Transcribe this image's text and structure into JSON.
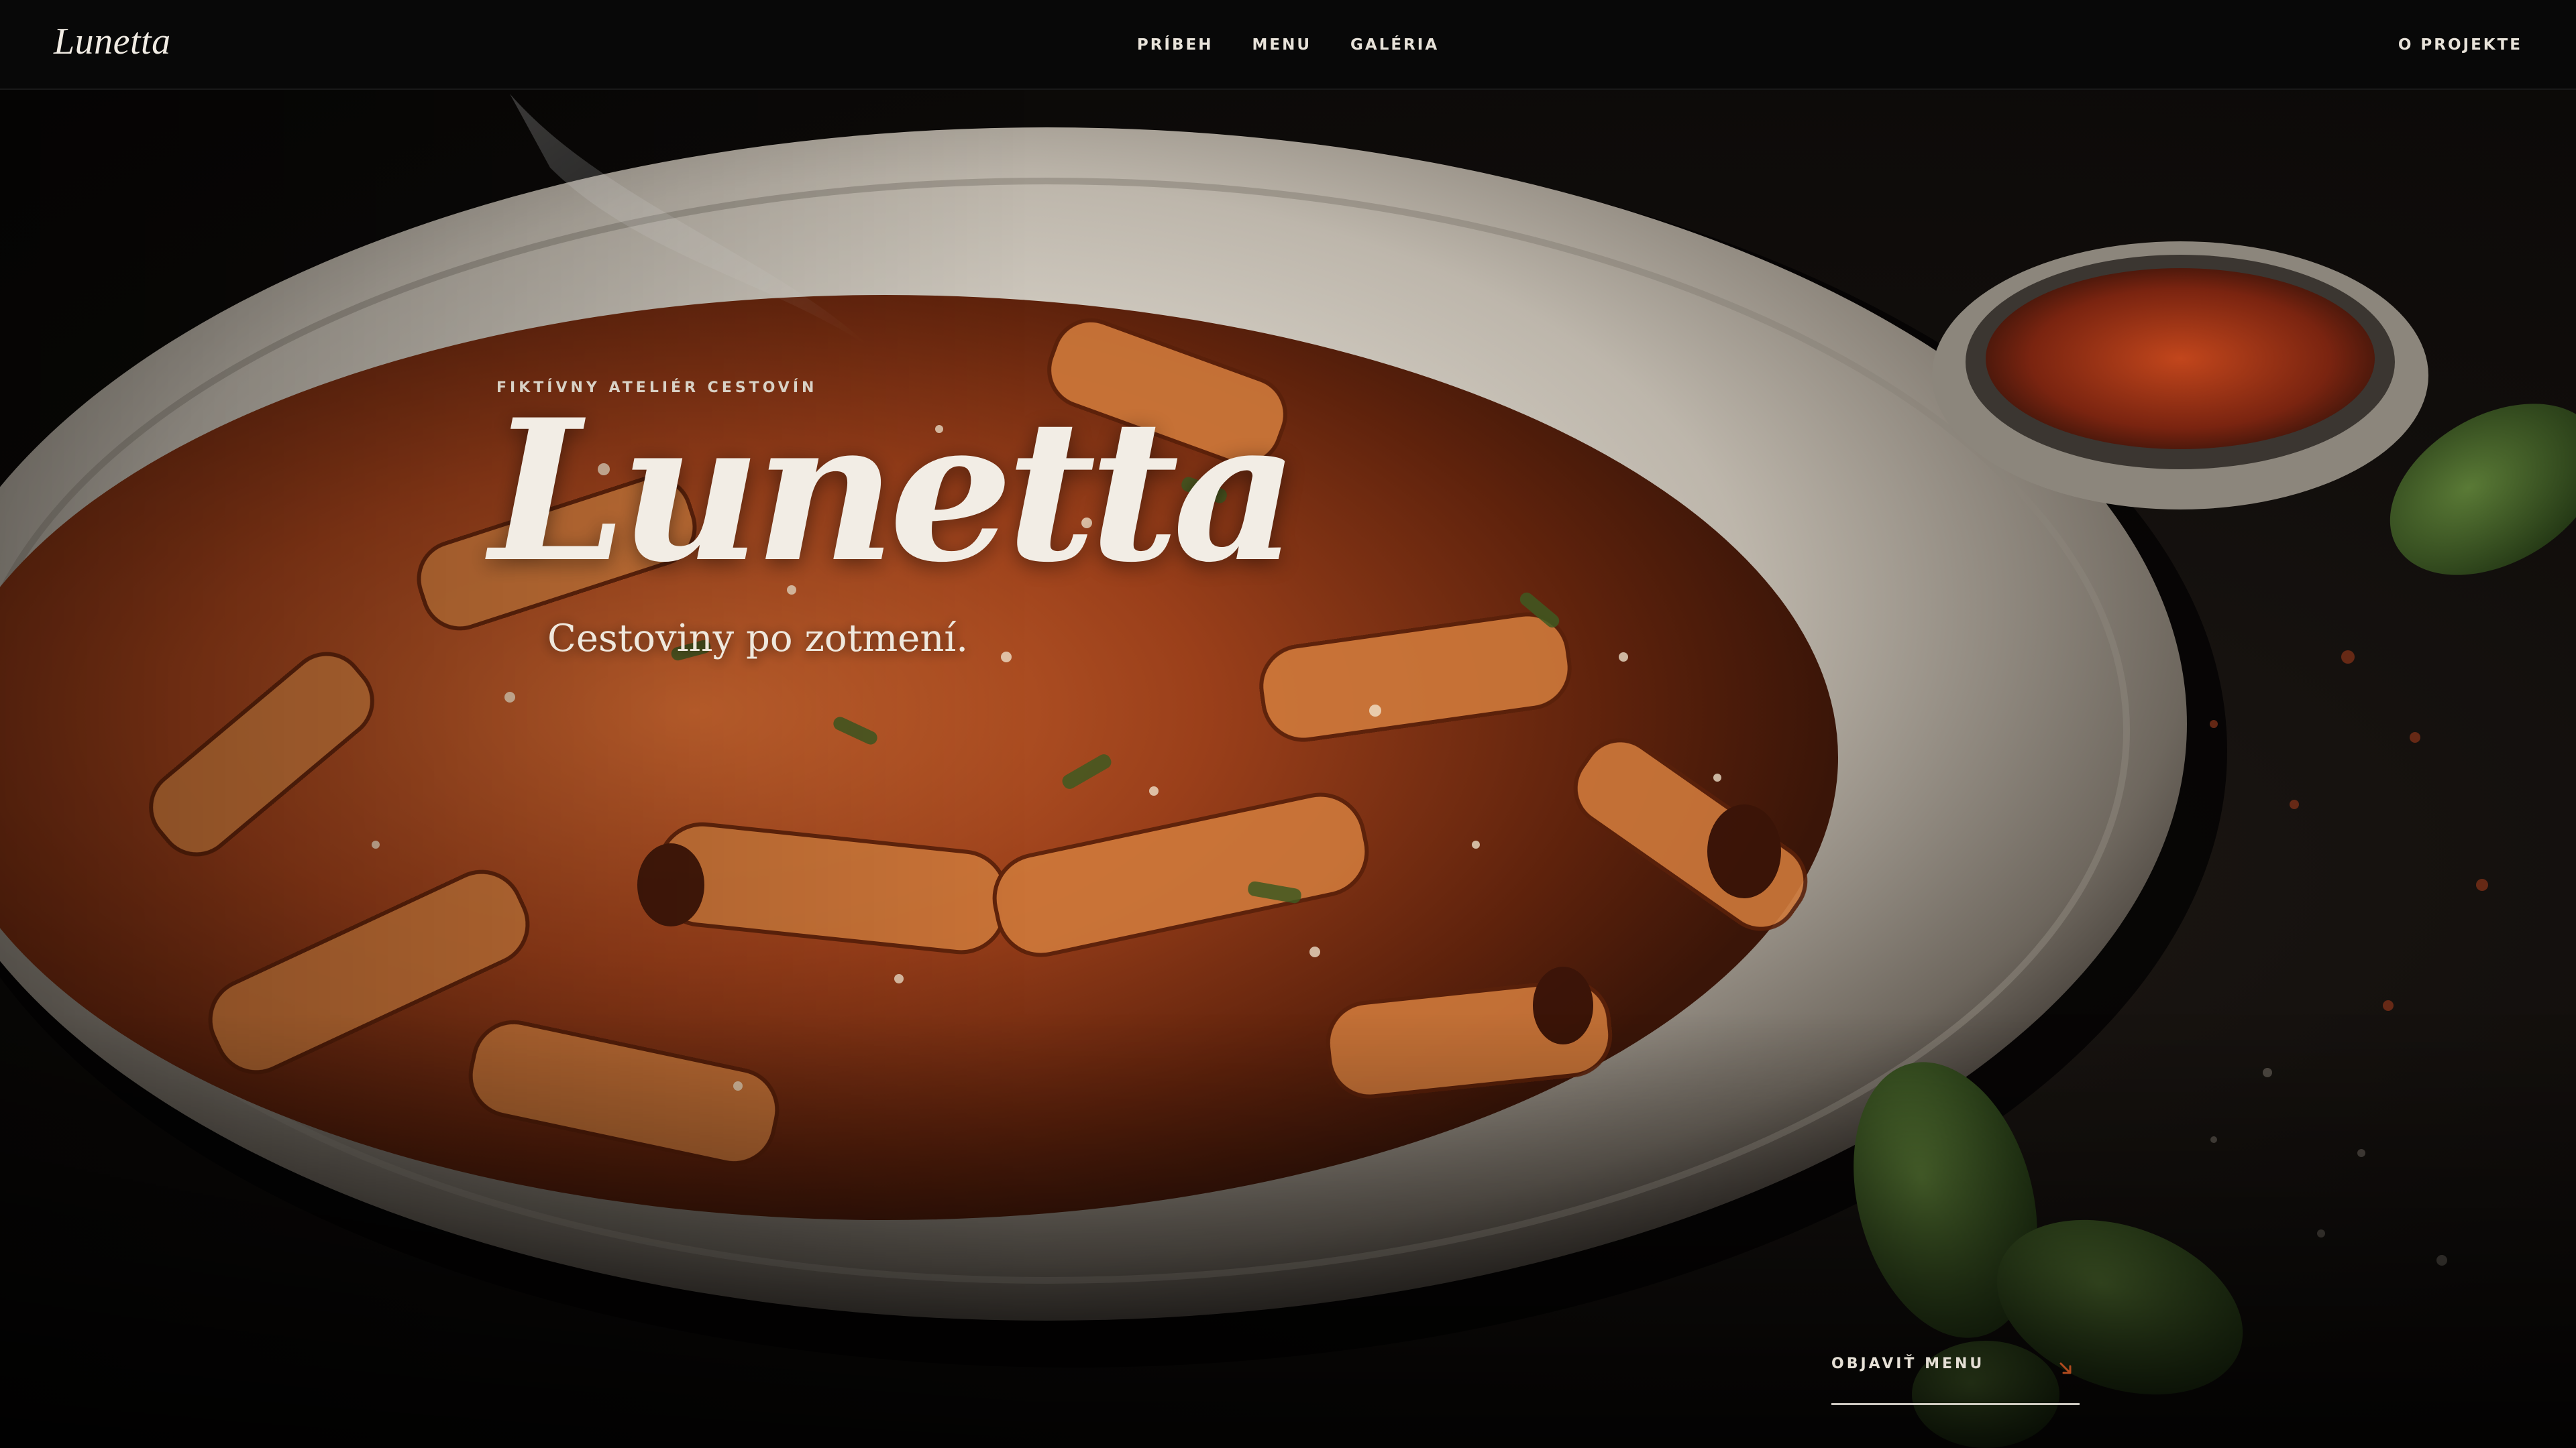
{
  "nav": {
    "brand": "Lunetta",
    "links": [
      "PRÍBEH",
      "MENU",
      "GALÉRIA"
    ],
    "right_link": "O PROJEKTE"
  },
  "hero": {
    "eyebrow": "FIKTÍVNY ATELIÉR CESTOVÍN",
    "title": "Lunetta",
    "subtitle": "Cestoviny po zotmení.",
    "background_image": "pasta-bowl-photo"
  },
  "cta": {
    "label": "OBJAVIŤ MENU",
    "icon": "arrow-down-right-icon"
  },
  "colors": {
    "background": "#0a0a0a",
    "text": "#f2ede5",
    "accent": "#b04a1e"
  }
}
